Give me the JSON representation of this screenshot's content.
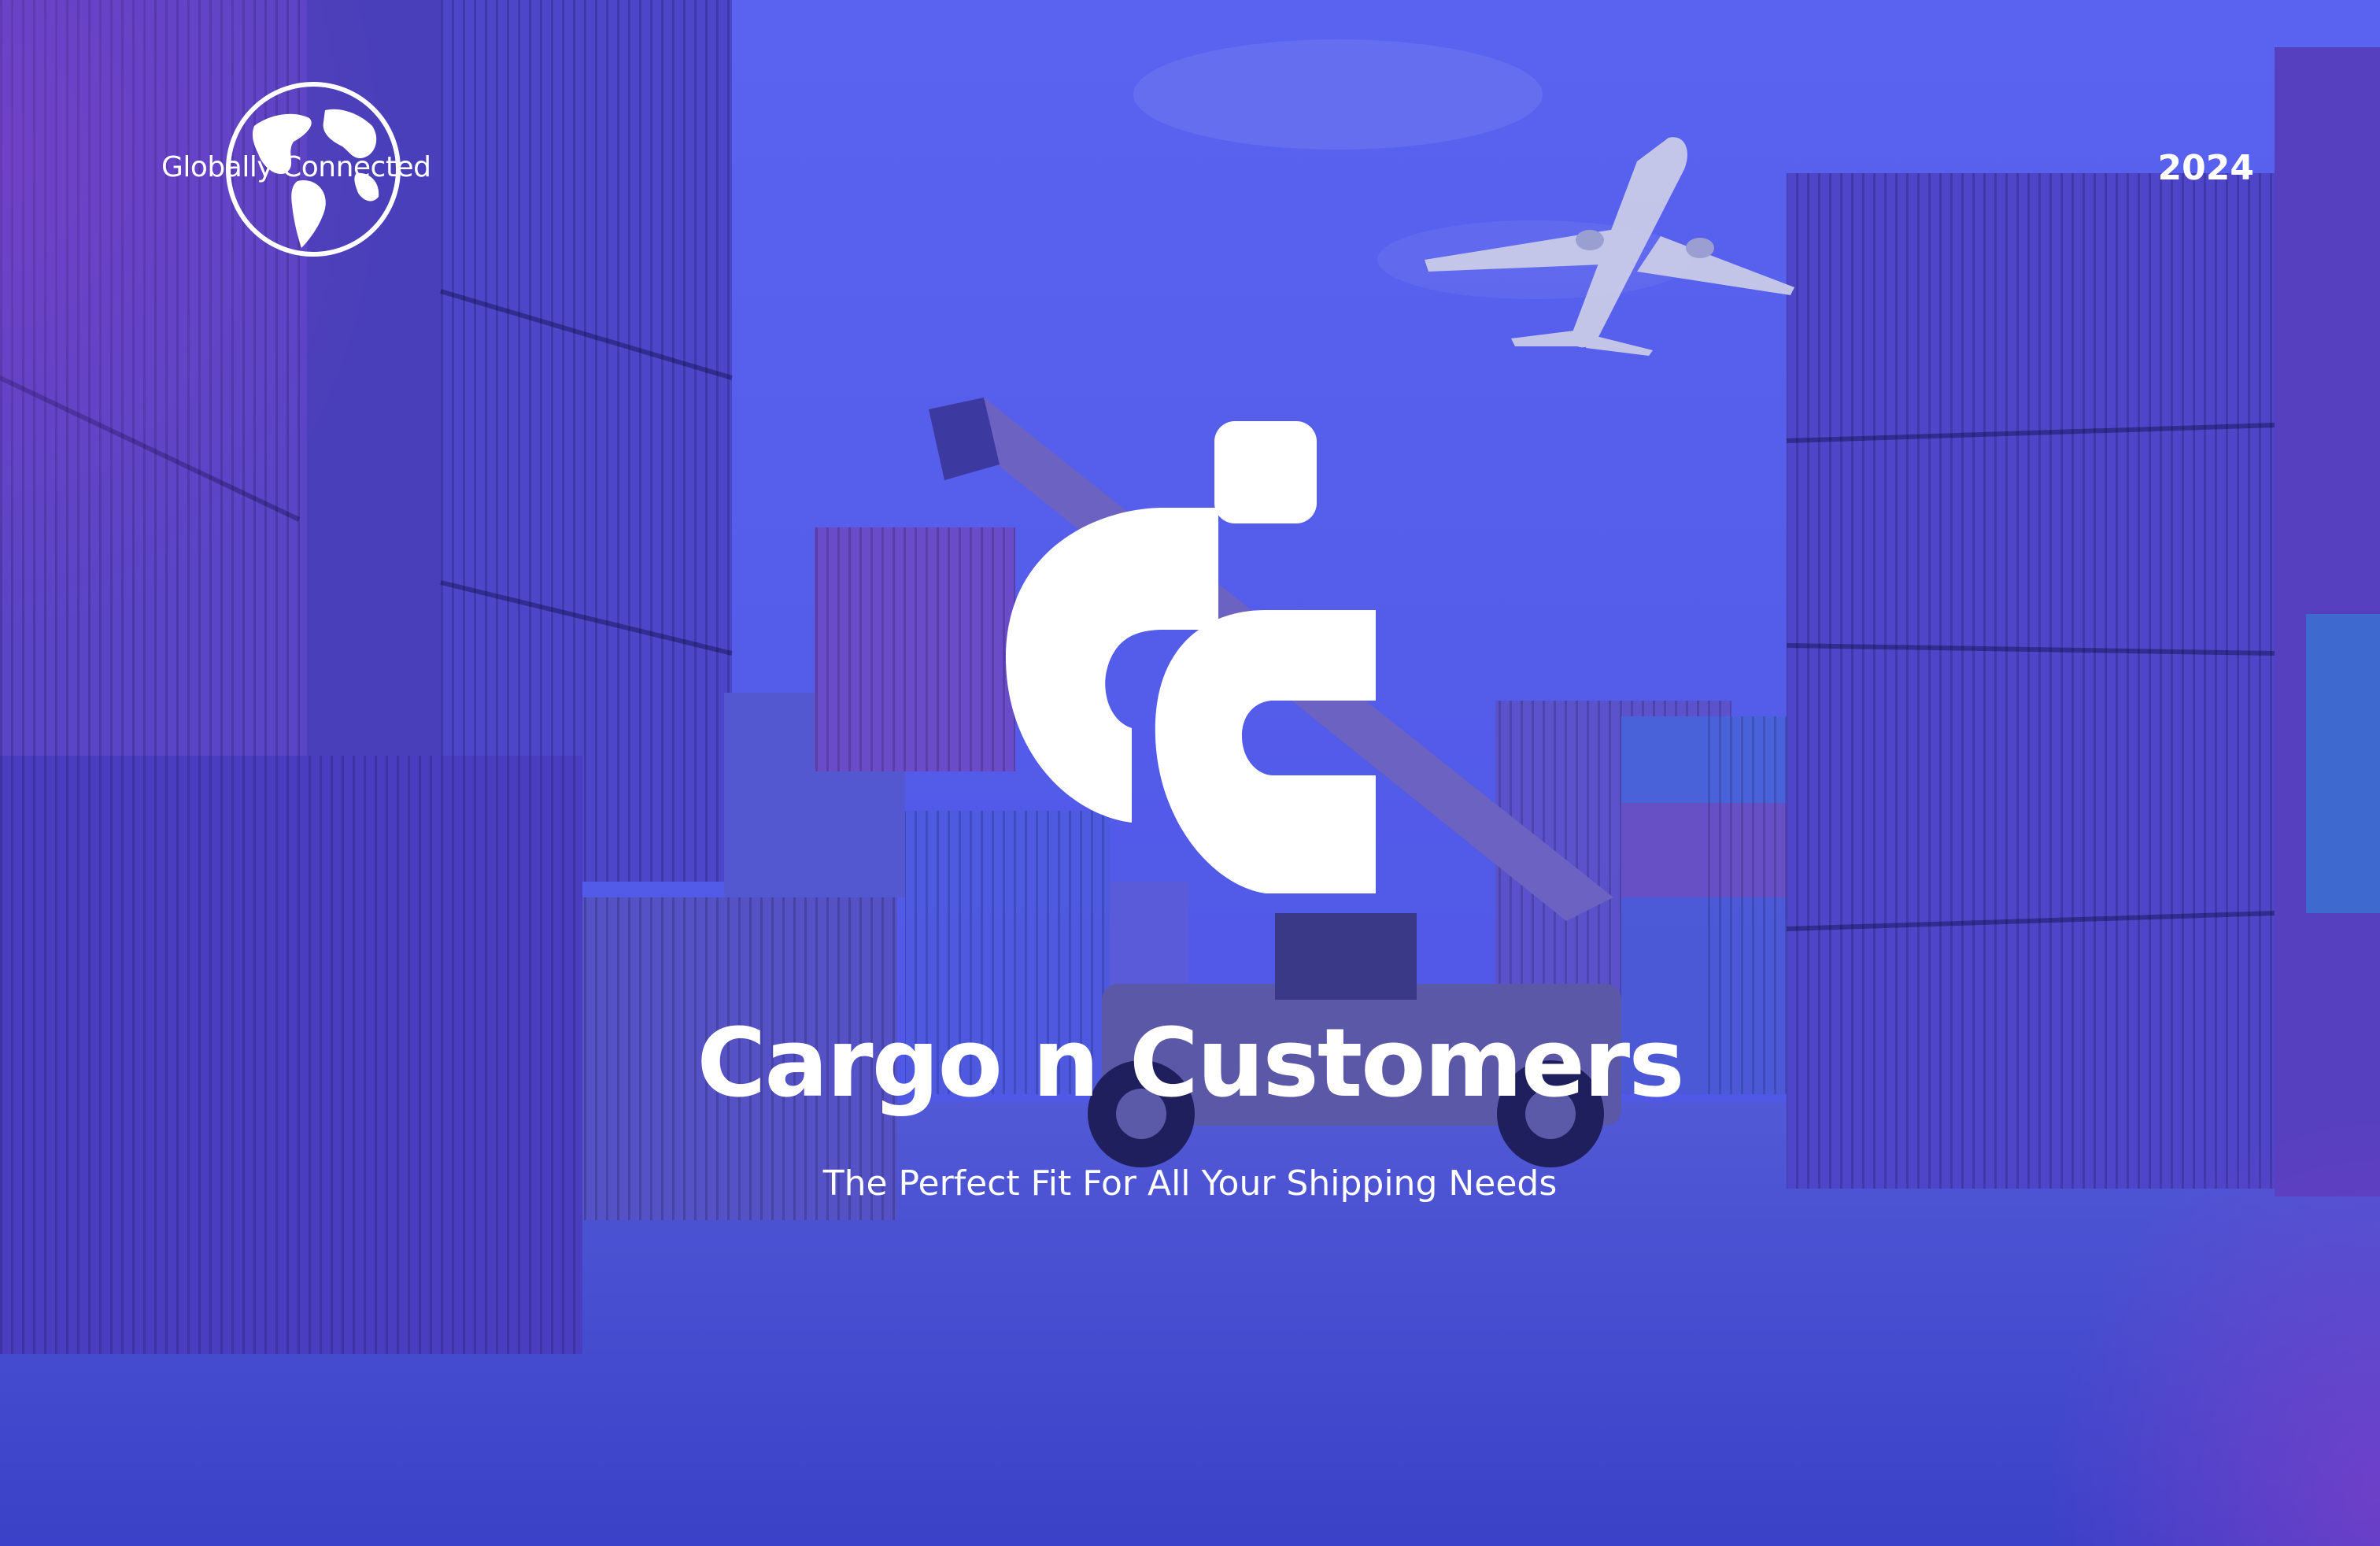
{
  "badge": {
    "label": "Globally Connected",
    "icon": "globe-icon"
  },
  "year": "2024",
  "brand": {
    "logo_icon": "cc-logo-icon",
    "title": "Cargo n Customers",
    "tagline": "The Perfect Fit For All Your Shipping Needs"
  },
  "colors": {
    "tint": "#4a4fe0",
    "accent_purple": "#8a3ec8",
    "text": "#ffffff"
  }
}
